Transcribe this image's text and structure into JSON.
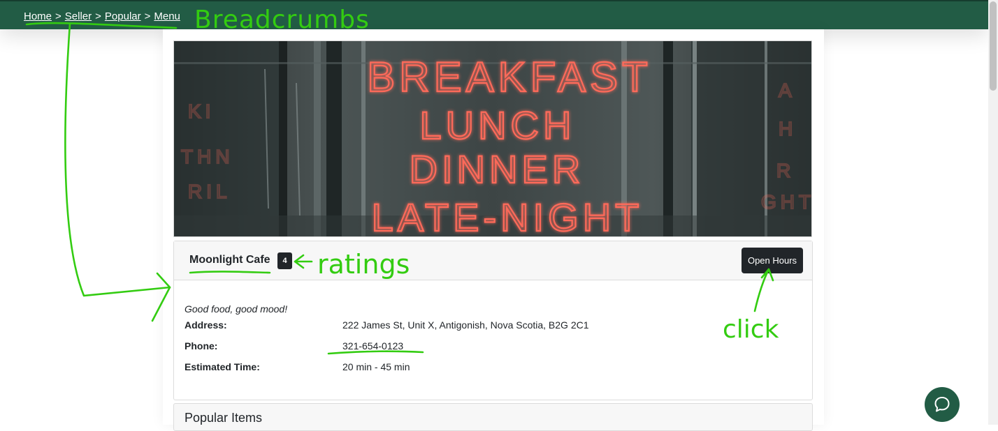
{
  "breadcrumb": {
    "items": [
      "Home",
      "Seller",
      "Popular",
      "Menu"
    ],
    "separator": ">"
  },
  "hero": {
    "neon_lines": [
      "BREAKFAST",
      "LUNCH",
      "DINNER",
      "LATE-NIGHT"
    ]
  },
  "shop": {
    "name": "Moonlight Cafe",
    "rating": "4",
    "open_hours_label": "Open Hours",
    "tagline": "Good food, good mood!",
    "address_label": "Address:",
    "address": "222 James St, Unit X, Antigonish, Nova Scotia, B2G 2C1",
    "phone_label": "Phone:",
    "phone": "321-654-0123",
    "time_label": "Estimated Time:",
    "time": "20 min - 45 min"
  },
  "popular": {
    "title": "Popular Items"
  },
  "annotations": {
    "breadcrumbs": "Breadcrumbs",
    "ratings": "ratings",
    "click": "click"
  },
  "colors": {
    "brand_green": "#225c45",
    "annotation_green": "#33cc11",
    "neon": "#ff6b5a",
    "dark": "#212529"
  },
  "icons": {
    "chat": "chat-bubble-icon"
  }
}
